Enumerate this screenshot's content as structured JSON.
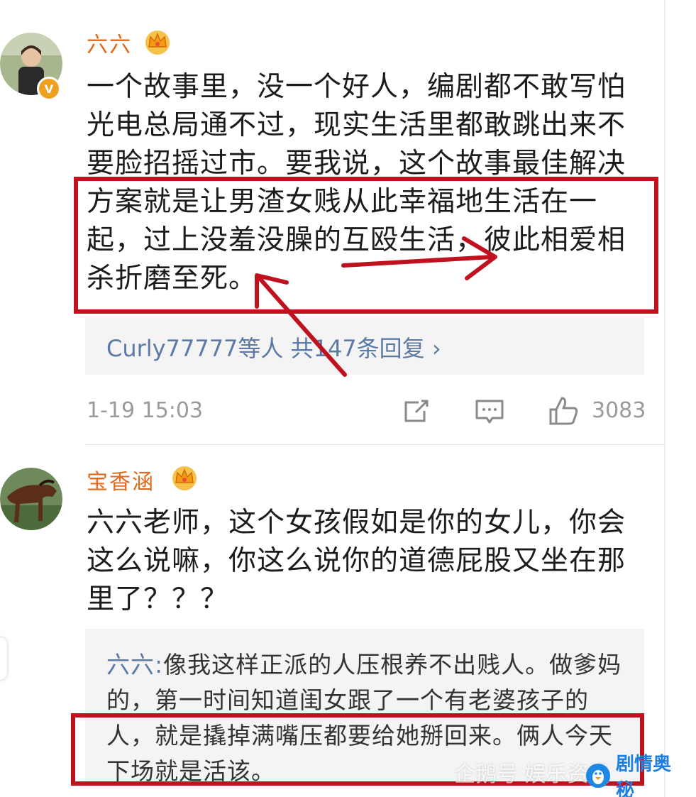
{
  "comments": [
    {
      "username": "六六",
      "text": "一个故事里，没一个好人，编剧都不敢写怕光电总局通不过，现实生活里都敢跳出来不要脸招摇过市。要我说，这个故事最佳解决方案就是让男渣女贱从此幸福地生活在一起，过上没羞没臊的互殴生活，彼此相爱相杀折磨至死。",
      "replies_link": "Curly77777等人 共147条回复 ›",
      "timestamp": "1-19 15:03",
      "like_count": "3083"
    },
    {
      "username": "宝香涵",
      "text": "六六老师，这个女孩假如是你的女儿，你会这么说嘛，你这么说你的道德屁股又坐在那里了？？？",
      "quote": {
        "author": "六六:",
        "text": "像我这样正派的人压根养不出贱人。做爹妈的，第一时间知道闺女跟了一个有老婆孩子的人，就是撬掉满嘴压都要给她掰回来。俩人今天下场就是活该。"
      }
    }
  ],
  "watermark": {
    "text": "企鹅号 娱乐资讯",
    "badge": "剧情奥秘"
  },
  "colors": {
    "username": "#e06a1e",
    "link": "#5b7aa6",
    "meta": "#9a9a9a",
    "annotation": "#c0121e",
    "reply_bg": "#f4f4f4"
  },
  "icons": [
    "crown-icon",
    "vip-badge-icon",
    "share-icon",
    "comment-icon",
    "like-icon",
    "penguin-logo-icon"
  ]
}
